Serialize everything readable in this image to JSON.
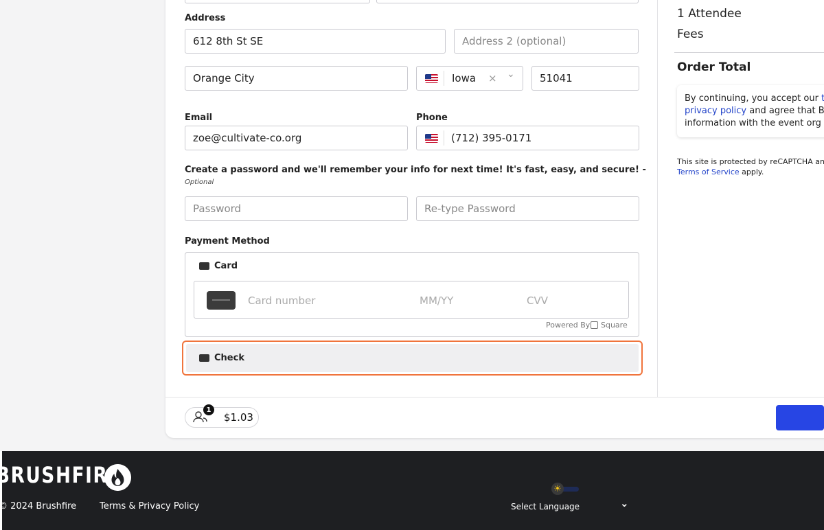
{
  "form": {
    "address_label": "Address",
    "address_value": "612 8th St SE",
    "address2_placeholder": "Address 2 (optional)",
    "city_value": "Orange City",
    "state_value": "Iowa",
    "state_clear": "×",
    "state_chevron": "⌄",
    "zip_value": "51041",
    "email_label": "Email",
    "email_value": "zoe@cultivate-co.org",
    "phone_label": "Phone",
    "phone_value": "(712) 395-0171",
    "password_heading": "Create a password and we'll remember your info for next time! It's fast, easy, and secure! -",
    "password_optional": "Optional",
    "password_placeholder": "Password",
    "retype_placeholder": "Re-type Password",
    "payment_label": "Payment Method",
    "card_option": "Card",
    "card_number_placeholder": "Card number",
    "expiry_placeholder": "MM/YY",
    "cvv_placeholder": "CVV",
    "powered_by": "Powered By",
    "square_label": "Square",
    "check_option": "Check"
  },
  "summary": {
    "attendees": "1 Attendee",
    "fees": "Fees",
    "order_total": "Order Total",
    "notice_line1": "By continuing, you accept our ",
    "notice_link1_visible": "t",
    "notice_link2": "privacy policy",
    "notice_line2": " and agree that B",
    "notice_line3": "information with the event org",
    "recaptcha_line1": "This site is protected by reCAPTCHA an",
    "recaptcha_link": "Terms of Service",
    "recaptcha_line2": " apply."
  },
  "bottom_bar": {
    "attendee_count": "1",
    "total": "$1.03"
  },
  "footer": {
    "logo": "BRUSHFIRE",
    "copyright": "© 2024 Brushfire",
    "terms": "Terms & Privacy Policy",
    "language": "Select Language",
    "language_chevron": "⌄",
    "theme_icon": "☀"
  },
  "colors": {
    "accent_button": "#2745e4",
    "highlight_outline": "#f0743c",
    "footer_bg": "#1e1f22",
    "link": "#2243c9"
  }
}
